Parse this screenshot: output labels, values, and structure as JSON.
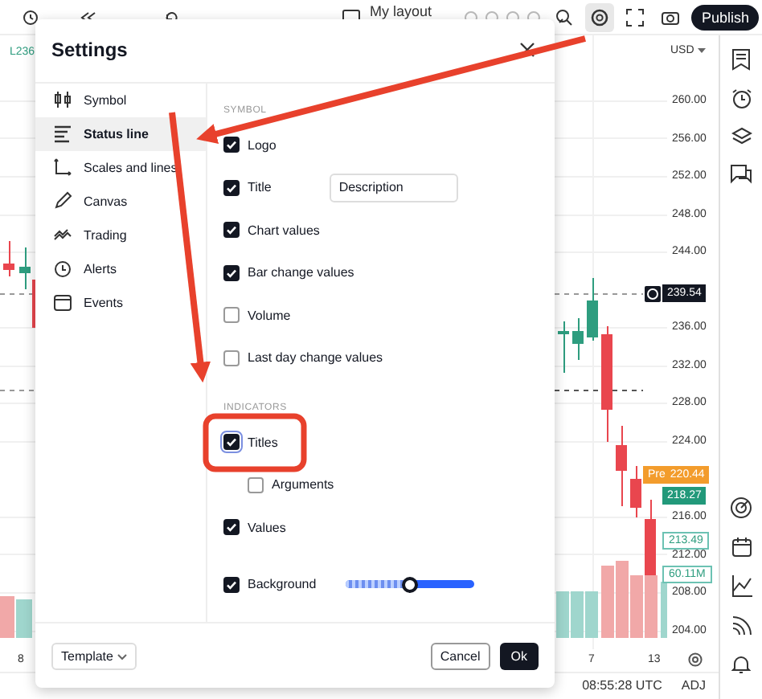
{
  "toolbar": {
    "layout": "My layout",
    "icons": [
      {
        "selected": false
      },
      {
        "selected": true
      },
      {
        "selected": false
      },
      {
        "selected": false
      }
    ],
    "publish": "Publish"
  },
  "legend": "L236",
  "currency": "USD",
  "price_axis": [
    "260.00",
    "256.00",
    "252.00",
    "248.00",
    "244.00",
    "236.00",
    "232.00",
    "228.00",
    "224.00",
    "216.00",
    "212.00",
    "208.00",
    "204.00"
  ],
  "price_tags": [
    {
      "kind": "last",
      "label": "239.54"
    },
    {
      "kind": "pre",
      "prefix": "Pre",
      "label": "220.44"
    },
    {
      "kind": "close",
      "label": "218.27"
    },
    {
      "kind": "outline",
      "label": "213.49"
    },
    {
      "kind": "volume",
      "label": "60.11M"
    }
  ],
  "time_axis": [
    "8",
    "7",
    "13"
  ],
  "status": {
    "time": "08:55:28 UTC",
    "adjustment": "ADJ"
  },
  "dialog": {
    "title": "Settings",
    "nav": [
      {
        "label": "Symbol",
        "selected": false
      },
      {
        "label": "Status line",
        "selected": true
      },
      {
        "label": "Scales and lines",
        "selected": false
      },
      {
        "label": "Canvas",
        "selected": false
      },
      {
        "label": "Trading",
        "selected": false
      },
      {
        "label": "Alerts",
        "selected": false
      },
      {
        "label": "Events",
        "selected": false
      }
    ],
    "sections": [
      {
        "heading": "SYMBOL",
        "rows": [
          {
            "label": "Logo",
            "checked": true
          },
          {
            "label": "Title",
            "checked": true,
            "select": "Description"
          },
          {
            "label": "Chart values",
            "checked": true
          },
          {
            "label": "Bar change values",
            "checked": true
          },
          {
            "label": "Volume",
            "checked": false
          },
          {
            "label": "Last day change values",
            "checked": false
          }
        ]
      },
      {
        "heading": "INDICATORS",
        "rows": [
          {
            "label": "Titles",
            "checked": true,
            "focused": true,
            "children": [
              {
                "label": "Arguments",
                "checked": false
              }
            ]
          },
          {
            "label": "Values",
            "checked": true
          },
          {
            "label": "Background",
            "checked": true,
            "level": 0.49
          }
        ]
      }
    ],
    "template": "Template",
    "cancel": "Cancel",
    "ok": "Ok"
  }
}
